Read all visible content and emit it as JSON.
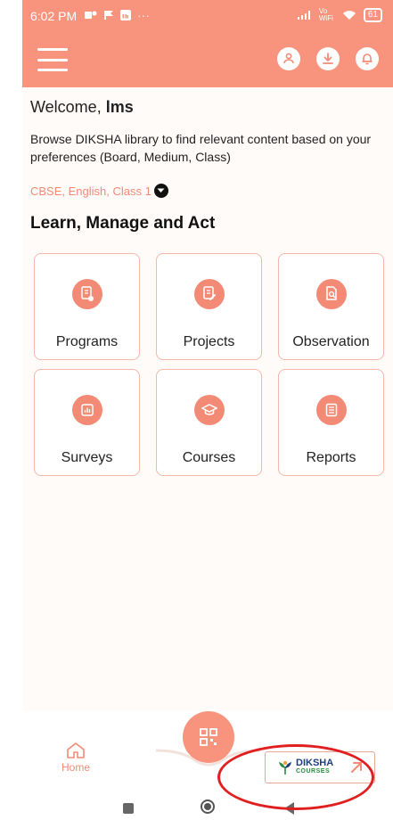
{
  "status_bar": {
    "time": "6:02 PM",
    "dots": "···",
    "network": "Vo WiFi",
    "battery": "61"
  },
  "header": {
    "menu_icon": "hamburger-icon",
    "icons": [
      "profile-icon",
      "download-icon",
      "notification-bell-icon"
    ]
  },
  "welcome": {
    "prefix": "Welcome, ",
    "name": "lms"
  },
  "browse_text": "Browse DIKSHA library to find relevant content based on your preferences (Board, Medium, Class)",
  "preferences": "CBSE, English, Class 1",
  "section_title": "Learn, Manage and Act",
  "tiles": [
    {
      "label": "Programs",
      "icon": "programs-icon"
    },
    {
      "label": "Projects",
      "icon": "projects-icon"
    },
    {
      "label": "Observation",
      "icon": "observation-icon"
    },
    {
      "label": "Surveys",
      "icon": "surveys-icon"
    },
    {
      "label": "Courses",
      "icon": "courses-icon"
    },
    {
      "label": "Reports",
      "icon": "reports-icon"
    }
  ],
  "bottom_nav": {
    "home_label": "Home",
    "qr_icon": "qr-scan-icon",
    "courses_button": {
      "brand_top": "DIKSHA",
      "brand_bottom": "COURSES"
    }
  },
  "colors": {
    "accent": "#f8937d",
    "accent_text": "#f28a76",
    "tile_border": "#f5b7a8",
    "highlight": "#e02020"
  }
}
